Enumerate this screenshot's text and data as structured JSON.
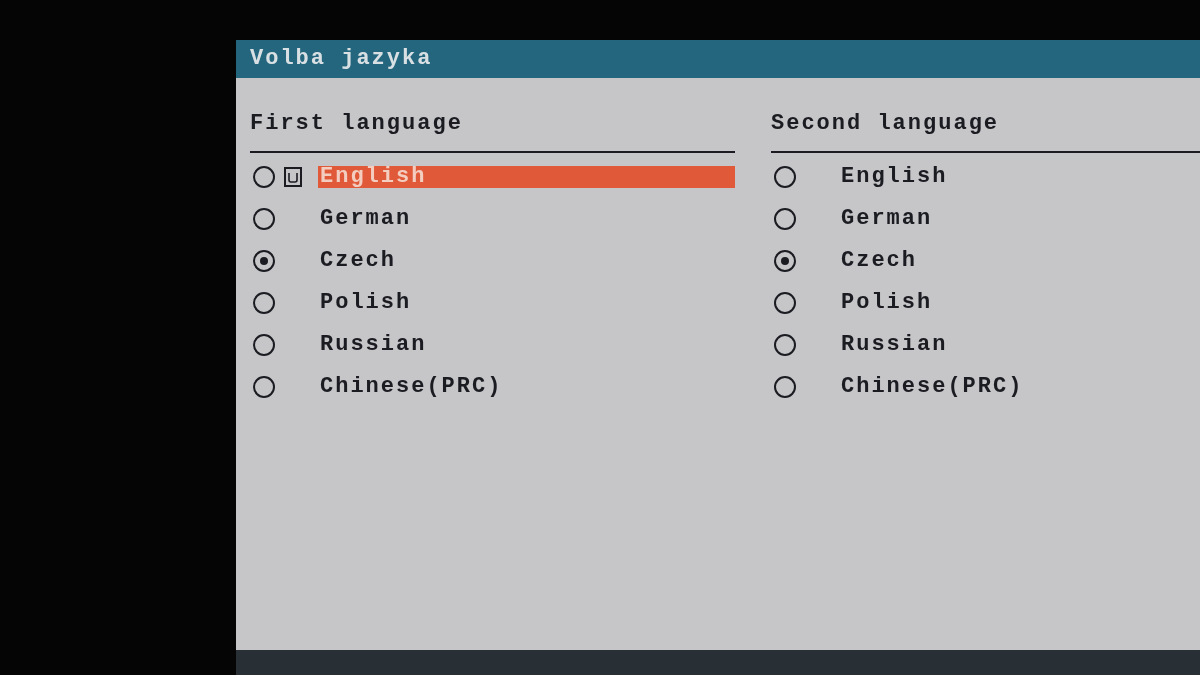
{
  "window": {
    "title": "Volba jazyka"
  },
  "columns": [
    {
      "heading": "First language",
      "options": [
        {
          "label": "English",
          "selected": false,
          "focused": true
        },
        {
          "label": "German",
          "selected": false,
          "focused": false
        },
        {
          "label": "Czech",
          "selected": true,
          "focused": false
        },
        {
          "label": "Polish",
          "selected": false,
          "focused": false
        },
        {
          "label": "Russian",
          "selected": false,
          "focused": false
        },
        {
          "label": "Chinese(PRC)",
          "selected": false,
          "focused": false
        }
      ]
    },
    {
      "heading": "Second language",
      "options": [
        {
          "label": "English",
          "selected": false,
          "focused": false
        },
        {
          "label": "German",
          "selected": false,
          "focused": false
        },
        {
          "label": "Czech",
          "selected": true,
          "focused": false
        },
        {
          "label": "Polish",
          "selected": false,
          "focused": false
        },
        {
          "label": "Russian",
          "selected": false,
          "focused": false
        },
        {
          "label": "Chinese(PRC)",
          "selected": false,
          "focused": false
        }
      ]
    }
  ]
}
